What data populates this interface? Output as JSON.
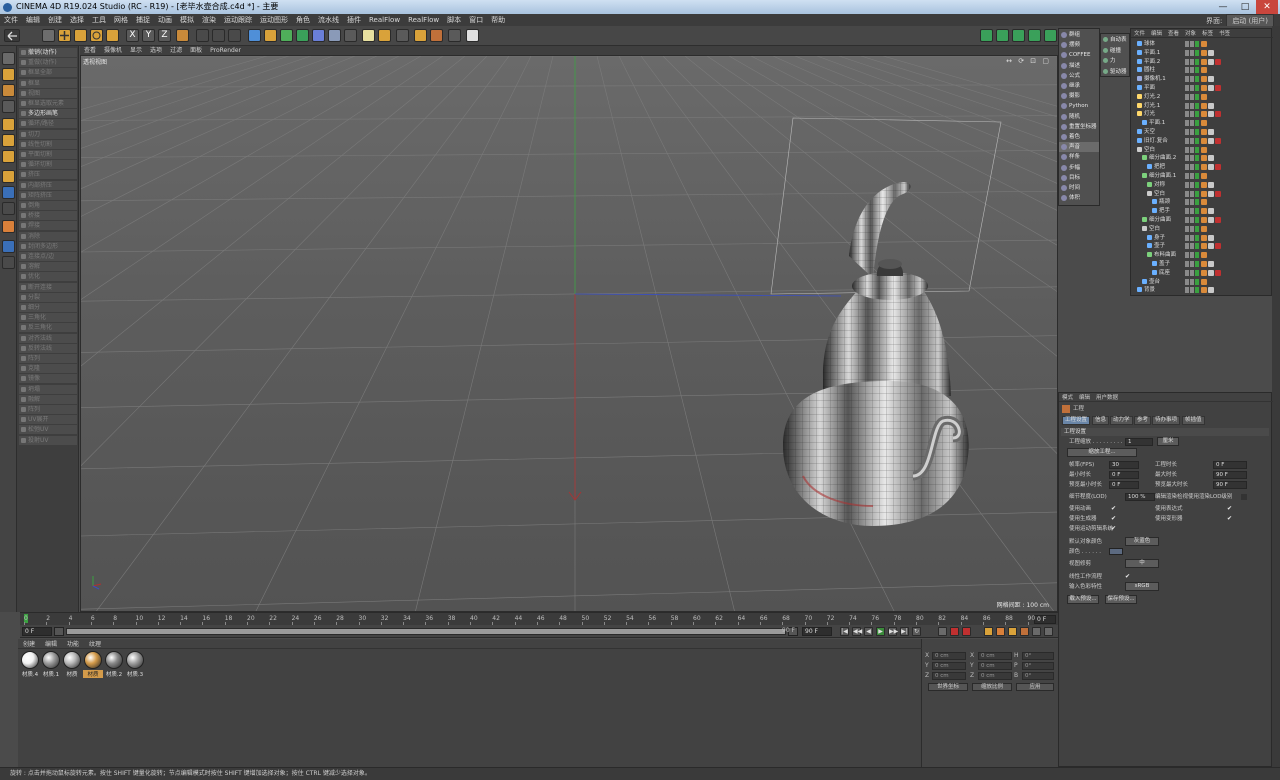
{
  "window": {
    "title": "CINEMA 4D R19.024 Studio (RC - R19) - [老毕水壶合成.c4d *] - 主要",
    "min": "—",
    "max": "□",
    "close": "✕"
  },
  "menu": [
    "文件",
    "编辑",
    "创建",
    "选择",
    "工具",
    "网格",
    "捕捉",
    "动画",
    "模拟",
    "渲染",
    "运动跟踪",
    "运动图形",
    "角色",
    "流水线",
    "插件",
    "RealFlow",
    "RealFlow",
    "脚本",
    "窗口",
    "帮助"
  ],
  "layout": {
    "label": "界面:",
    "value": "启动 (用户)"
  },
  "viewport": {
    "menu": [
      "查看",
      "摄像机",
      "显示",
      "选项",
      "过滤",
      "面板",
      "ProRender"
    ],
    "label": "透视视图",
    "scale": "网格间距 : 100 cm",
    "corner": "↔ ⟳ ⊡ ▢"
  },
  "left_panel": [
    {
      "label": "撤销(动作)",
      "on": true
    },
    {
      "label": "重做(动作)",
      "on": false
    },
    {
      "label": "框显全部",
      "on": false
    },
    {
      "label": "框显",
      "on": false
    },
    {
      "label": "视图",
      "on": false
    },
    {
      "label": "框显选取元素",
      "on": false
    },
    {
      "label": "多边形画笔",
      "on": true
    },
    {
      "label": "循环/路径",
      "on": false
    },
    {
      "label": "切刀",
      "on": false
    },
    {
      "label": "线性切割",
      "on": false
    },
    {
      "label": "平面切割",
      "on": false
    },
    {
      "label": "循环切割",
      "on": false
    },
    {
      "label": "挤压",
      "on": false
    },
    {
      "label": "内部挤压",
      "on": false
    },
    {
      "label": "矩阵挤压",
      "on": false
    },
    {
      "label": "倒角",
      "on": false
    },
    {
      "label": "桥接",
      "on": false
    },
    {
      "label": "焊接",
      "on": false
    },
    {
      "label": "消除",
      "on": false
    },
    {
      "label": "封闭多边形",
      "on": false
    },
    {
      "label": "连接点/边",
      "on": false
    },
    {
      "label": "溶解",
      "on": false
    },
    {
      "label": "优化",
      "on": false
    },
    {
      "label": "断开连接",
      "on": false
    },
    {
      "label": "分裂",
      "on": false
    },
    {
      "label": "细分",
      "on": false
    },
    {
      "label": "三角化",
      "on": false
    },
    {
      "label": "反三角化",
      "on": false
    },
    {
      "label": "对齐法线",
      "on": false
    },
    {
      "label": "反转法线",
      "on": false
    },
    {
      "label": "阵列",
      "on": false
    },
    {
      "label": "克隆",
      "on": false
    },
    {
      "label": "镜像",
      "on": false
    },
    {
      "label": "坍塌",
      "on": false
    },
    {
      "label": "融解",
      "on": false
    },
    {
      "label": "阵列",
      "on": false
    },
    {
      "label": "UV展开",
      "on": false
    },
    {
      "label": "松弛UV",
      "on": false
    },
    {
      "label": "投射UV",
      "on": false
    }
  ],
  "timeline": {
    "ticks": [
      "0",
      "2",
      "4",
      "6",
      "8",
      "10",
      "12",
      "14",
      "16",
      "18",
      "20",
      "22",
      "24",
      "26",
      "28",
      "30",
      "32",
      "34",
      "36",
      "38",
      "40",
      "42",
      "44",
      "46",
      "48",
      "50",
      "52",
      "54",
      "56",
      "58",
      "60",
      "62",
      "64",
      "66",
      "68",
      "70",
      "72",
      "74",
      "76",
      "78",
      "80",
      "82",
      "84",
      "86",
      "88",
      "90"
    ],
    "frame_end": "0 F",
    "start": "0 F",
    "current": "0 F",
    "end_min": "90 F",
    "end_max": "90 F"
  },
  "transport": [
    "|◀",
    "◀◀",
    "◀",
    "▶",
    "▶▶",
    "▶|",
    "↻"
  ],
  "materials": {
    "menu": [
      "创建",
      "编辑",
      "功能",
      "纹理"
    ],
    "items": [
      {
        "name": "材质.4",
        "color": "#f2f2f2",
        "sel": false
      },
      {
        "name": "材质.1",
        "color": "#9c9c9c",
        "sel": false
      },
      {
        "name": "材质",
        "color": "#b8b8b8",
        "sel": false
      },
      {
        "name": "材质",
        "color": "#d49b4a",
        "sel": true
      },
      {
        "name": "材质.2",
        "color": "#8a8a8a",
        "sel": false
      },
      {
        "name": "材质.3",
        "color": "#a0a0a0",
        "sel": false
      }
    ]
  },
  "coords": {
    "rows": [
      {
        "a": "X",
        "v1": "0 cm",
        "b": "X",
        "v2": "0 cm",
        "c": "H",
        "v3": "0°"
      },
      {
        "a": "Y",
        "v1": "0 cm",
        "b": "Y",
        "v2": "0 cm",
        "c": "P",
        "v3": "0°"
      },
      {
        "a": "Z",
        "v1": "0 cm",
        "b": "Z",
        "v2": "0 cm",
        "c": "B",
        "v3": "0°"
      }
    ],
    "world": "世界坐标",
    "scale": "缩放比例",
    "apply": "应用"
  },
  "status": "旋转 : 点击并拖动鼠标旋转元素。按住 SHIFT 键量化旋转；节点编辑模式时按住 SHIFT 键增加选择对象；按住 CTRL 键减少选择对象。",
  "context_menu": [
    "群组",
    "摆频",
    "COFFEE",
    "描述",
    "公式",
    "继承",
    "摄影",
    "Python",
    "随机",
    "重置坐标器",
    "着色",
    "声音",
    "样条",
    "步幅",
    "目标",
    "时间",
    "体积"
  ],
  "submenu": [
    "自动表",
    "碰撞",
    "力",
    "驱动器"
  ],
  "objects": {
    "menu": [
      "文件",
      "编辑",
      "查看",
      "对象",
      "标签",
      "书签"
    ],
    "rows": [
      {
        "name": "球体",
        "d": 0,
        "ic": "#6ab0ff"
      },
      {
        "name": "平面.1",
        "d": 0,
        "ic": "#6ab0ff"
      },
      {
        "name": "平面.2",
        "d": 0,
        "ic": "#6ab0ff"
      },
      {
        "name": "圆柱",
        "d": 0,
        "ic": "#6ab0ff"
      },
      {
        "name": "摄像机.1",
        "d": 0,
        "ic": "#9ad"
      },
      {
        "name": "平面",
        "d": 0,
        "ic": "#6ab0ff"
      },
      {
        "name": "灯光.2",
        "d": 0,
        "ic": "#ffd86a"
      },
      {
        "name": "灯光.1",
        "d": 0,
        "ic": "#ffd86a"
      },
      {
        "name": "灯光",
        "d": 0,
        "ic": "#ffd86a"
      },
      {
        "name": "平面.1",
        "d": 1,
        "ic": "#6ab0ff"
      },
      {
        "name": "天空",
        "d": 0,
        "ic": "#6ab0ff"
      },
      {
        "name": "旧灯.复合",
        "d": 0,
        "ic": "#6ab0ff"
      },
      {
        "name": "空白",
        "d": 0,
        "ic": "#ccc"
      },
      {
        "name": "细分曲面.2",
        "d": 1,
        "ic": "#7cd17c"
      },
      {
        "name": "把把",
        "d": 2,
        "ic": "#6ab0ff"
      },
      {
        "name": "细分曲面.1",
        "d": 1,
        "ic": "#7cd17c"
      },
      {
        "name": "对称",
        "d": 2,
        "ic": "#7cd17c"
      },
      {
        "name": "空白",
        "d": 2,
        "ic": "#ccc"
      },
      {
        "name": "瓶颈",
        "d": 3,
        "ic": "#6ab0ff"
      },
      {
        "name": "把手",
        "d": 3,
        "ic": "#6ab0ff"
      },
      {
        "name": "细分曲面",
        "d": 1,
        "ic": "#7cd17c"
      },
      {
        "name": "空白",
        "d": 1,
        "ic": "#ccc"
      },
      {
        "name": "身子",
        "d": 2,
        "ic": "#6ab0ff"
      },
      {
        "name": "壶子",
        "d": 2,
        "ic": "#6ab0ff"
      },
      {
        "name": "布料曲面",
        "d": 2,
        "ic": "#7cd17c"
      },
      {
        "name": "盖子",
        "d": 3,
        "ic": "#6ab0ff"
      },
      {
        "name": "底座",
        "d": 3,
        "ic": "#6ab0ff"
      },
      {
        "name": "壶台",
        "d": 1,
        "ic": "#6ab0ff"
      },
      {
        "name": "背景",
        "d": 0,
        "ic": "#6ab0ff"
      }
    ]
  },
  "attributes": {
    "menu": [
      "模式",
      "编辑",
      "用户数据"
    ],
    "head": "工程",
    "tabs": [
      "工程设置",
      "信息",
      "动力学",
      "参考",
      "待办事项",
      "帧插值"
    ],
    "section": "工程设置",
    "scale_label": "工程缩放 . . . . . . . . .",
    "scale_value": "1",
    "scale_unit": "厘米",
    "scale_btn": "缩放工程...",
    "fps_label": "帧率(FPS)",
    "fps": "30",
    "min_label": "最小时长",
    "min": "0 F",
    "pmin_label": "预览最小时长",
    "pmin": "0 F",
    "proj_len_label": "工程时长",
    "proj_len": "0 F",
    "max_label": "最大时长",
    "max": "90 F",
    "pmax_label": "预览最大时长",
    "pmax": "90 F",
    "lod_label": "细节程度(LOD)",
    "lod": "100 %",
    "lod_check": "编辑渲染检视使用渲染LOD级别",
    "c1": "使用动画",
    "c2": "使用表达式",
    "c3": "使用生成器",
    "c4": "使用变形器",
    "c5": "使用运动剪辑系统",
    "color_label": "默认对象颜色",
    "color_value": "灰蓝色",
    "color2_label": "颜色 . . . . . .",
    "view_label": "视图修剪",
    "view_value": "中",
    "linear_label": "线性工作流程",
    "input_label": "输入色彩特性",
    "input_value": "sRGB",
    "load_btn": "载入预设...",
    "save_btn": "保存预设..."
  }
}
